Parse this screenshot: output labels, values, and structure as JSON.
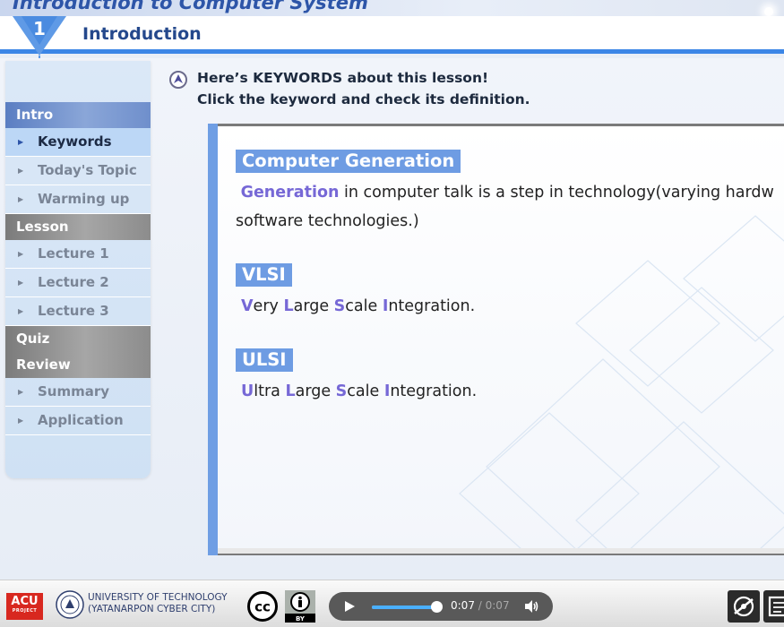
{
  "course_title": "Introduction to Computer System",
  "header": {
    "chapter_number": "1",
    "title": "Introduction"
  },
  "sidebar": {
    "sections": [
      {
        "label": "Intro"
      },
      {
        "label": "Lesson"
      },
      {
        "label": "Quiz"
      },
      {
        "label": "Review"
      }
    ],
    "items": [
      {
        "label": "Keywords",
        "active": true
      },
      {
        "label": "Today's Topic"
      },
      {
        "label": "Warming up"
      },
      {
        "label": "Lecture 1"
      },
      {
        "label": "Lecture 2"
      },
      {
        "label": "Lecture 3"
      },
      {
        "label": "Summary"
      },
      {
        "label": "Application"
      }
    ]
  },
  "instructions": {
    "line1": "Here’s KEYWORDS about this lesson!",
    "line2": "Click the keyword and check its definition."
  },
  "keywords": [
    {
      "term": "Computer Generation",
      "def_highlight": "Generation",
      "def_line1": " in computer talk is a step in technology(varying hardw",
      "def_line2": "software technologies.)"
    },
    {
      "term": "VLSI",
      "parts": [
        {
          "h": "V",
          "t": "ery "
        },
        {
          "h": "L",
          "t": "arge "
        },
        {
          "h": "S",
          "t": "cale "
        },
        {
          "h": "I",
          "t": "ntegration."
        }
      ]
    },
    {
      "term": "ULSI",
      "parts": [
        {
          "h": "U",
          "t": "ltra "
        },
        {
          "h": "L",
          "t": "arge "
        },
        {
          "h": "S",
          "t": "cale "
        },
        {
          "h": "I",
          "t": "ntegration."
        }
      ]
    }
  ],
  "footer": {
    "acu_label": "ACU",
    "acu_sub": "PROJECT",
    "university_line1": "UNIVERSITY OF TECHNOLOGY",
    "university_line2": "(YATANARPON CYBER CITY)",
    "license_cc": "cc",
    "license_by": "BY",
    "player": {
      "current_time": "0:07",
      "separator": " / ",
      "duration": "0:07",
      "progress": 1.0
    }
  },
  "colors": {
    "accent_blue": "#3c86e6",
    "keyword_bg": "#6e9ce3",
    "highlight_purple": "#7668d6",
    "acu_red": "#d8281f"
  }
}
